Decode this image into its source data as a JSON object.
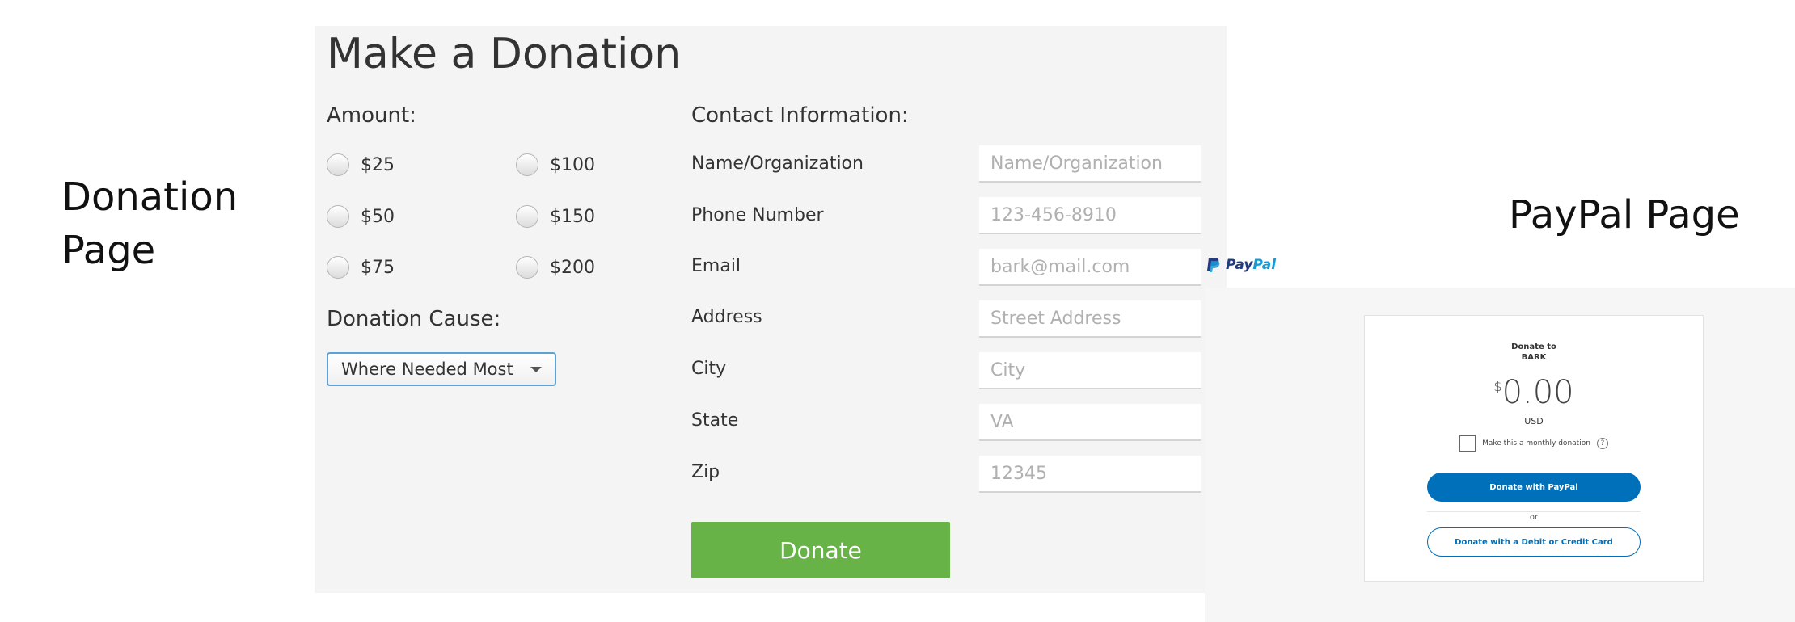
{
  "captions": {
    "donation_page": [
      "Donation",
      "Page"
    ],
    "paypal_page": "PayPal Page"
  },
  "donation_form": {
    "title": "Make a Donation",
    "amount_label": "Amount:",
    "amounts": [
      "$25",
      "$100",
      "$50",
      "$150",
      "$75",
      "$200"
    ],
    "cause_label": "Donation Cause:",
    "cause_selected": "Where Needed Most",
    "contact_label": "Contact Information:",
    "fields": [
      {
        "label": "Name/Organization",
        "placeholder": "Name/Organization"
      },
      {
        "label": "Phone Number",
        "placeholder": "123-456-8910"
      },
      {
        "label": "Email",
        "placeholder": "bark@mail.com"
      },
      {
        "label": "Address",
        "placeholder": "Street Address"
      },
      {
        "label": "City",
        "placeholder": "City"
      },
      {
        "label": "State",
        "placeholder": "VA"
      },
      {
        "label": "Zip",
        "placeholder": "12345"
      }
    ],
    "donate_button": "Donate",
    "colors": {
      "donate_button": "#67b347",
      "select_border": "#5ba3d6"
    }
  },
  "paypal": {
    "brand": {
      "pay": "Pay",
      "pal": "Pal"
    },
    "donate_to": "Donate to",
    "recipient": "BARK",
    "currency_symbol": "$",
    "amount": "0.00",
    "currency": "USD",
    "monthly_label": "Make this a monthly donation",
    "help_glyph": "?",
    "primary_button": "Donate with PayPal",
    "or_text": "or",
    "secondary_button": "Donate with a Debit or Credit Card",
    "colors": {
      "primary": "#0070ba",
      "brand_dark": "#253b80",
      "brand_light": "#179bd7"
    }
  }
}
